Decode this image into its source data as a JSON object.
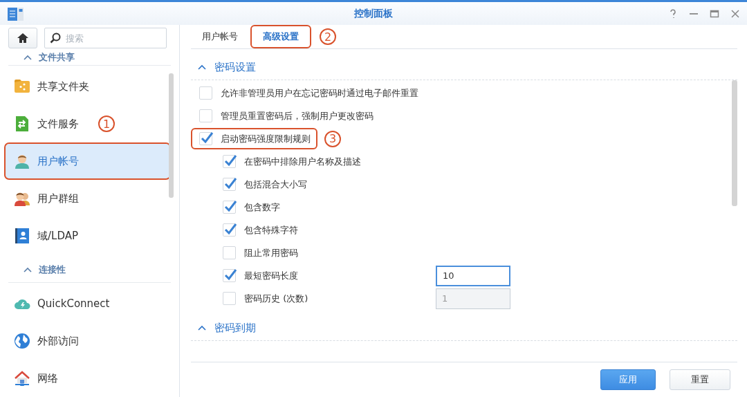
{
  "window": {
    "title": "控制面板",
    "controls": [
      {
        "kind": "help"
      },
      {
        "kind": "minimize"
      },
      {
        "kind": "maximize"
      },
      {
        "kind": "close"
      }
    ]
  },
  "sidebar": {
    "search": {
      "placeholder": "搜索"
    },
    "groups": [
      {
        "title": "文件共享",
        "items": [
          {
            "label": "共享文件夹",
            "selected": false,
            "outlined": false
          },
          {
            "label": "文件服务",
            "selected": false,
            "outlined": false,
            "callout": "1"
          },
          {
            "label": "用户帐号",
            "selected": true,
            "outlined": true
          },
          {
            "label": "用户群组",
            "selected": false,
            "outlined": false
          },
          {
            "label": "域/LDAP",
            "selected": false,
            "outlined": false
          }
        ]
      },
      {
        "title": "连接性",
        "items": [
          {
            "label": "QuickConnect",
            "selected": false,
            "outlined": false
          },
          {
            "label": "外部访问",
            "selected": false,
            "outlined": false
          },
          {
            "label": "网络",
            "selected": false,
            "outlined": false
          }
        ]
      }
    ]
  },
  "tabs": [
    {
      "label": "用户帐号",
      "selected": false,
      "outlined": false
    },
    {
      "label": "高级设置",
      "selected": true,
      "outlined": true,
      "callout": "2"
    }
  ],
  "sections": [
    {
      "title": "密码设置",
      "expanded": true,
      "options": [
        {
          "label": "允许非管理员用户在忘记密码时通过电子邮件重置",
          "checked": false,
          "outlined": false
        },
        {
          "label": "管理员重置密码后，强制用户更改密码",
          "checked": false,
          "outlined": false
        },
        {
          "label": "启动密码强度限制规则",
          "checked": true,
          "outlined": true,
          "callout": "3",
          "children": [
            {
              "label": "在密码中排除用户名称及描述",
              "checked": true
            },
            {
              "label": "包括混合大小写",
              "checked": true
            },
            {
              "label": "包含数字",
              "checked": true
            },
            {
              "label": "包含特殊字符",
              "checked": true
            },
            {
              "label": "阻止常用密码",
              "checked": false
            },
            {
              "label": "最短密码长度",
              "checked": true,
              "field": {
                "value": "10",
                "disabled": false
              }
            },
            {
              "label": "密码历史 (次数)",
              "checked": false,
              "field": {
                "value": "1",
                "disabled": true
              }
            }
          ]
        }
      ]
    },
    {
      "title": "密码到期",
      "expanded": true
    }
  ],
  "buttons": [
    {
      "label": "应用",
      "kind": "primary"
    },
    {
      "label": "重置",
      "kind": "secondary"
    }
  ]
}
